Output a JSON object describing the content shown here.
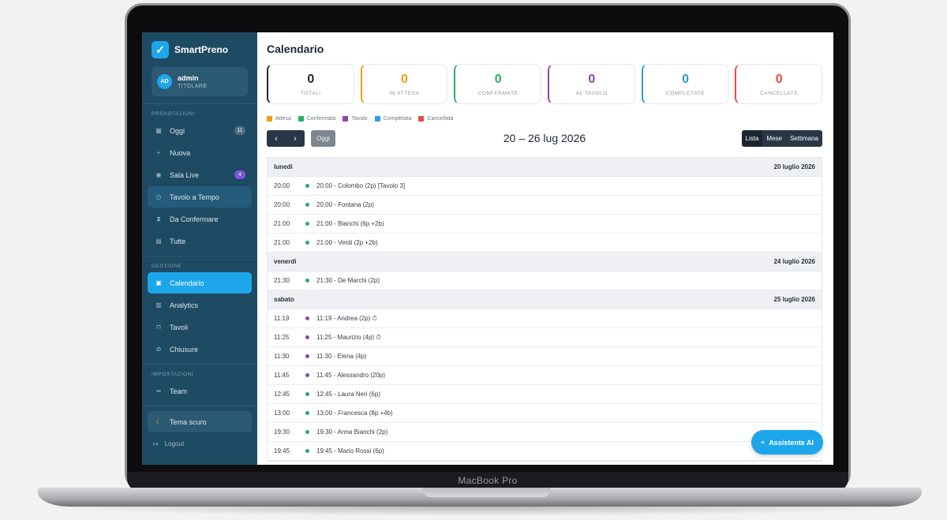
{
  "device": {
    "label": "MacBook Pro"
  },
  "app": {
    "name": "SmartPreno",
    "logo_glyph": "✓"
  },
  "user": {
    "initials": "AD",
    "name": "admin",
    "role": "TITOLARE"
  },
  "sidebar": {
    "section_prenotazioni": "PRENOTAZIONI",
    "section_gestione": "GESTIONE",
    "section_impostazioni": "IMPOSTAZIONI",
    "items": [
      {
        "label": "Oggi",
        "icon": "clipboard-icon",
        "glyph": "▦",
        "badge": "11"
      },
      {
        "label": "Nuova",
        "icon": "plus-icon",
        "glyph": "+"
      },
      {
        "label": "Sala Live",
        "icon": "dish-icon",
        "glyph": "◉",
        "badge": "4"
      },
      {
        "label": "Tavolo a Tempo",
        "icon": "timer-icon",
        "glyph": "◷"
      },
      {
        "label": "Da Confermare",
        "icon": "hourglass-icon",
        "glyph": "⧗"
      },
      {
        "label": "Tutte",
        "icon": "list-icon",
        "glyph": "▤"
      },
      {
        "label": "Calendario",
        "icon": "calendar-icon",
        "glyph": "▣"
      },
      {
        "label": "Analytics",
        "icon": "chart-icon",
        "glyph": "▥"
      },
      {
        "label": "Tavoli",
        "icon": "chair-icon",
        "glyph": "⊓"
      },
      {
        "label": "Chiusure",
        "icon": "no-entry-icon",
        "glyph": "⊘"
      },
      {
        "label": "Team",
        "icon": "team-icon",
        "glyph": "▪▪"
      },
      {
        "label": "Tema scuro",
        "icon": "moon-icon",
        "glyph": "☾"
      },
      {
        "label": "Logout",
        "icon": "logout-icon",
        "glyph": "↦"
      }
    ]
  },
  "page": {
    "title": "Calendario"
  },
  "stats": [
    {
      "value": "0",
      "label": "TOTALI",
      "color": "#1d2733"
    },
    {
      "value": "0",
      "label": "IN ATTESA",
      "color": "#f39c12"
    },
    {
      "value": "0",
      "label": "CONFERMATE",
      "color": "#27ae60"
    },
    {
      "value": "0",
      "label": "AL TAVOLO",
      "color": "#8e44ad"
    },
    {
      "value": "0",
      "label": "COMPLETATE",
      "color": "#3498db"
    },
    {
      "value": "0",
      "label": "CANCELLATE",
      "color": "#e74c3c"
    }
  ],
  "legend": [
    {
      "label": "Attesa",
      "color": "#f39c12"
    },
    {
      "label": "Confermata",
      "color": "#27ae60"
    },
    {
      "label": "Tavolo",
      "color": "#8e44ad"
    },
    {
      "label": "Completata",
      "color": "#3498db"
    },
    {
      "label": "Cancellata",
      "color": "#e74c3c"
    }
  ],
  "toolbar": {
    "prev_glyph": "‹",
    "next_glyph": "›",
    "today_label": "Oggi",
    "range": "20 – 26 lug 2026",
    "views": [
      "Lista",
      "Mese",
      "Settimana"
    ],
    "active_view": "Lista"
  },
  "days": [
    {
      "weekday": "lunedì",
      "date": "20 luglio 2026",
      "events": [
        {
          "time": "20:00",
          "title": "20:00 - Colombo (2p) [Tavolo 3]",
          "color": "#27ae60"
        },
        {
          "time": "20:00",
          "title": "20:00 - Fontana (2p)",
          "color": "#27ae60"
        },
        {
          "time": "21:00",
          "title": "21:00 - Bianchi (6p +2b)",
          "color": "#27ae60"
        },
        {
          "time": "21:00",
          "title": "21:00 - Verdi (2p +2b)",
          "color": "#27ae60"
        }
      ]
    },
    {
      "weekday": "venerdì",
      "date": "24 luglio 2026",
      "events": [
        {
          "time": "21:30",
          "title": "21:30 - De Marchi (2p)",
          "color": "#27ae60"
        }
      ]
    },
    {
      "weekday": "sabato",
      "date": "25 luglio 2026",
      "events": [
        {
          "time": "11:19",
          "title": "11:19 - Andrea (2p) ⏱",
          "color": "#8e44ad"
        },
        {
          "time": "11:25",
          "title": "11:25 - Maurizio (4p) ⏱",
          "color": "#8e44ad"
        },
        {
          "time": "11:30",
          "title": "11:30 - Elena (4p)",
          "color": "#8e44ad"
        },
        {
          "time": "11:45",
          "title": "11:45 - Alessandro (20p)",
          "color": "#8e44ad"
        },
        {
          "time": "12:45",
          "title": "12:45 - Laura Neri (6p)",
          "color": "#27ae60"
        },
        {
          "time": "13:00",
          "title": "13:00 - Francesca (8p +4b)",
          "color": "#27ae60"
        },
        {
          "time": "19:30",
          "title": "19:30 - Anna Bianchi (2p)",
          "color": "#27ae60"
        },
        {
          "time": "19:45",
          "title": "19:45 - Mario Rossi (6p)",
          "color": "#27ae60"
        }
      ]
    }
  ],
  "assistant": {
    "label": "Assistente AI",
    "glyph": "◓"
  }
}
